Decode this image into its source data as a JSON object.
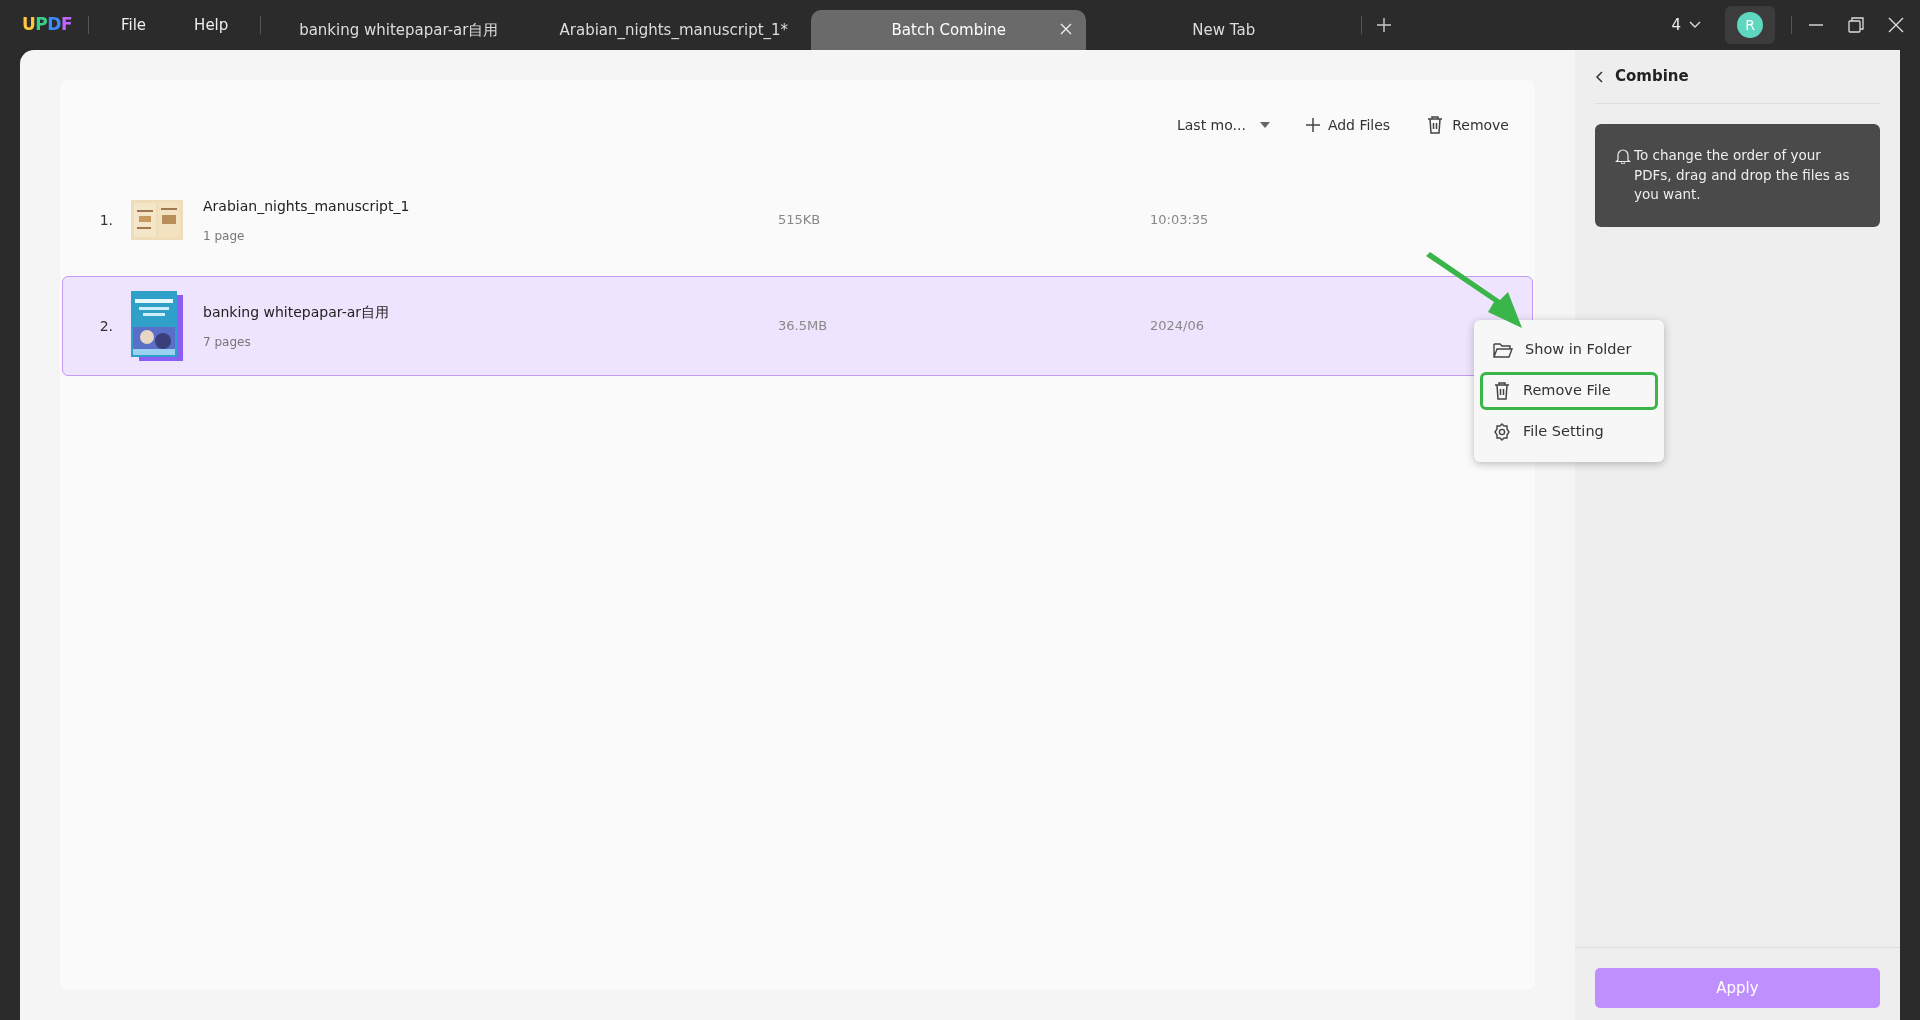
{
  "title_bar": {
    "logo": "UPDF",
    "menus": [
      "File",
      "Help"
    ],
    "tabs": [
      {
        "label": "banking whitepapar-ar自用",
        "selected": false
      },
      {
        "label": "Arabian_nights_manuscript_1*",
        "selected": false
      },
      {
        "label": "Batch Combine",
        "selected": true
      },
      {
        "label": "New Tab",
        "selected": false
      }
    ],
    "window_count": "4",
    "avatar": "R"
  },
  "toolbar": {
    "sort": "Last mo...",
    "actions": [
      {
        "label": "Add Files",
        "kind": "add"
      },
      {
        "label": "Remove",
        "kind": "trash"
      }
    ]
  },
  "files": [
    {
      "index": "1.",
      "name": "Arabian_nights_manuscript_1",
      "pages": "1 page",
      "size": "515KB",
      "date": "10:03:35",
      "selected": false
    },
    {
      "index": "2.",
      "name": "banking whitepapar-ar自用",
      "pages": "7 pages",
      "size": "36.5MB",
      "date": "2024/06",
      "selected": true
    }
  ],
  "context_menu": [
    {
      "label": "Show in Folder",
      "kind": "folder",
      "highlighted": false
    },
    {
      "label": "Remove File",
      "kind": "trash",
      "highlighted": true
    },
    {
      "label": "File Setting",
      "kind": "gear",
      "highlighted": false
    }
  ],
  "panel": {
    "title": "Combine",
    "tip": "To change the order of your PDFs, drag and drop the files as you want.",
    "apply": {
      "label": "Apply",
      "disabled": true
    }
  }
}
